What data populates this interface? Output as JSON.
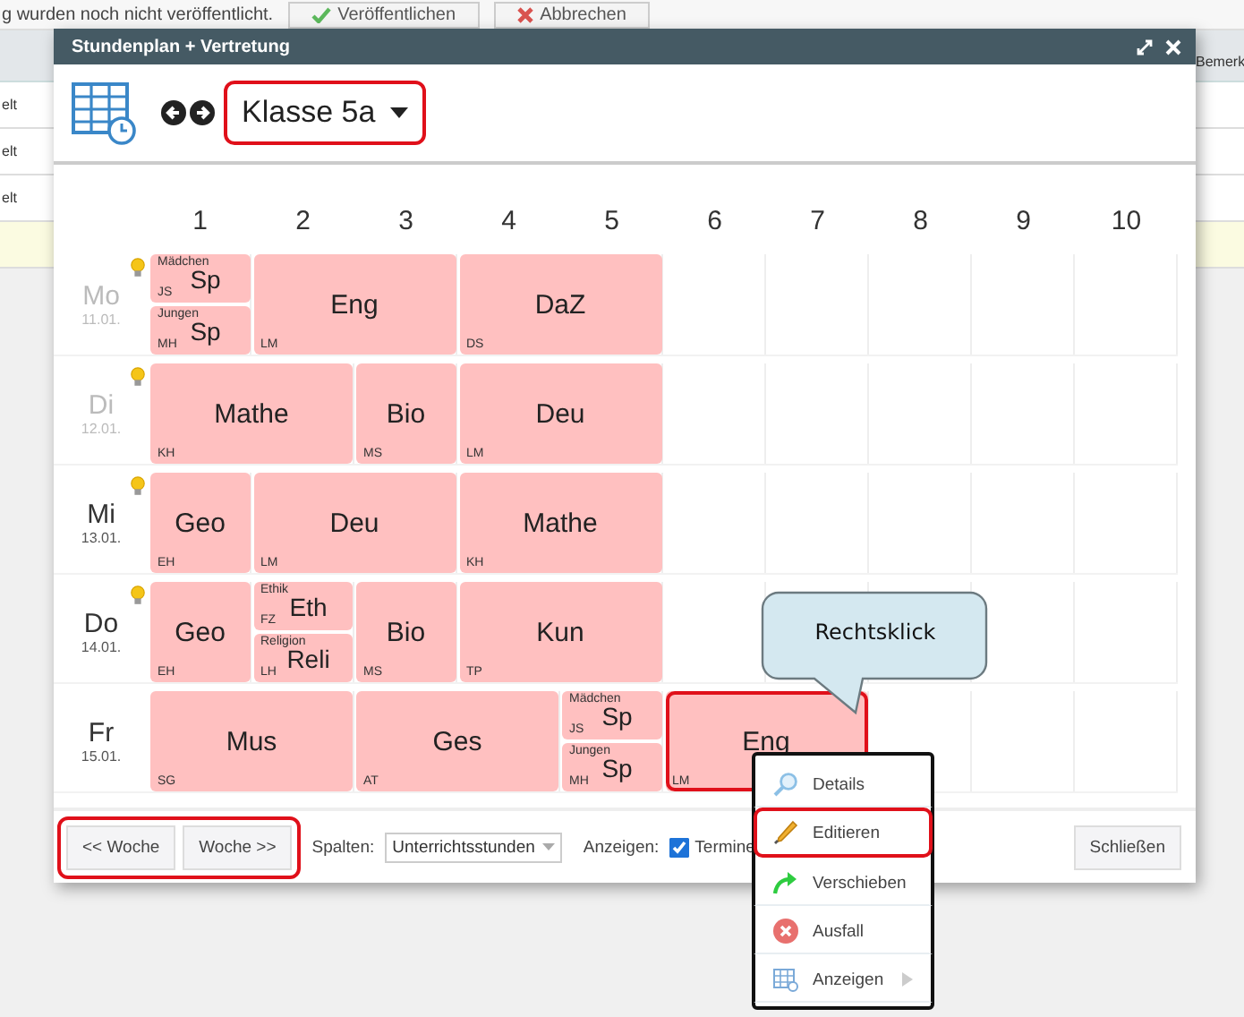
{
  "background": {
    "notice": "g wurden noch nicht veröffentlicht.",
    "buttons": [
      {
        "label": "Veröffentlichen",
        "kind": "confirm"
      },
      {
        "label": "Abbrechen",
        "kind": "cancel"
      }
    ],
    "column_header": "Bemerk",
    "rows": [
      {
        "cell": "elt"
      },
      {
        "cell": "elt"
      },
      {
        "cell": "elt"
      }
    ]
  },
  "dialog": {
    "title": "Stundenplan + Vertretung",
    "class_selector": {
      "value": "Klasse 5a",
      "annotated": true
    },
    "periods": [
      "1",
      "2",
      "3",
      "4",
      "5",
      "6",
      "7",
      "8",
      "9",
      "10"
    ],
    "days": [
      {
        "day": "Mo",
        "date": "11.01.",
        "past": true,
        "note": true,
        "lessons": [
          {
            "kind": "split",
            "annotated": false,
            "parts": [
              {
                "group": "Mädchen",
                "subject": "Sp",
                "teacher": "JS"
              },
              {
                "group": "Jungen",
                "subject": "Sp",
                "teacher": "MH"
              }
            ]
          },
          {
            "kind": "double",
            "subject": "Eng",
            "teacher": "LM",
            "annotated": false
          },
          {
            "kind": "double",
            "subject": "DaZ",
            "teacher": "DS",
            "annotated": false
          }
        ]
      },
      {
        "day": "Di",
        "date": "12.01.",
        "past": true,
        "note": true,
        "lessons": [
          {
            "kind": "double",
            "subject": "Mathe",
            "teacher": "KH",
            "annotated": false
          },
          {
            "kind": "single",
            "subject": "Bio",
            "teacher": "MS",
            "annotated": false
          },
          {
            "kind": "double",
            "subject": "Deu",
            "teacher": "LM",
            "annotated": false
          }
        ]
      },
      {
        "day": "Mi",
        "date": "13.01.",
        "past": false,
        "note": true,
        "lessons": [
          {
            "kind": "single",
            "subject": "Geo",
            "teacher": "EH",
            "annotated": false
          },
          {
            "kind": "double",
            "subject": "Deu",
            "teacher": "LM",
            "annotated": false
          },
          {
            "kind": "double",
            "subject": "Mathe",
            "teacher": "KH",
            "annotated": false
          }
        ]
      },
      {
        "day": "Do",
        "date": "14.01.",
        "past": false,
        "note": true,
        "lessons": [
          {
            "kind": "single",
            "subject": "Geo",
            "teacher": "EH",
            "annotated": false
          },
          {
            "kind": "split",
            "annotated": false,
            "parts": [
              {
                "group": "Ethik",
                "subject": "Eth",
                "teacher": "FZ"
              },
              {
                "group": "Religion",
                "subject": "Reli",
                "teacher": "LH"
              }
            ]
          },
          {
            "kind": "single",
            "subject": "Bio",
            "teacher": "MS",
            "annotated": false
          },
          {
            "kind": "double",
            "subject": "Kun",
            "teacher": "TP",
            "annotated": false
          }
        ]
      },
      {
        "day": "Fr",
        "date": "15.01.",
        "past": false,
        "note": false,
        "lessons": [
          {
            "kind": "double",
            "subject": "Mus",
            "teacher": "SG",
            "annotated": false
          },
          {
            "kind": "double",
            "subject": "Ges",
            "teacher": "AT",
            "annotated": false
          },
          {
            "kind": "split",
            "annotated": false,
            "parts": [
              {
                "group": "Mädchen",
                "subject": "Sp",
                "teacher": "JS"
              },
              {
                "group": "Jungen",
                "subject": "Sp",
                "teacher": "MH"
              }
            ]
          },
          {
            "kind": "double",
            "subject": "Eng",
            "teacher": "LM",
            "annotated": true
          }
        ]
      }
    ],
    "footer": {
      "week_buttons": [
        "<< Woche",
        "Woche >>"
      ],
      "week_annotated": true,
      "columns_label": "Spalten:",
      "columns_value": "Unterrichtsstunden",
      "show_label": "Anzeigen:",
      "show_option": {
        "label": "Termine",
        "checked": true
      },
      "close": "Schließen"
    }
  },
  "callout": "Rechtsklick",
  "context_menu": [
    {
      "kind": "details",
      "label": "Details",
      "annotated": false,
      "submenu": false
    },
    {
      "kind": "edit",
      "label": "Editieren",
      "annotated": true,
      "submenu": false
    },
    {
      "kind": "move",
      "label": "Verschieben",
      "annotated": false,
      "submenu": false
    },
    {
      "kind": "cancel",
      "label": "Ausfall",
      "annotated": false,
      "submenu": false
    },
    {
      "kind": "show",
      "label": "Anzeigen",
      "annotated": false,
      "submenu": true
    }
  ]
}
